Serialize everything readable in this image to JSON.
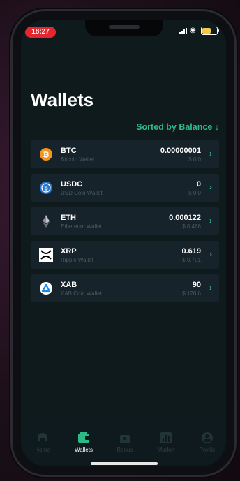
{
  "status": {
    "time": "18:27",
    "battery_charge": 0.6
  },
  "header": {
    "title": "Wallets",
    "sort_label": "Sorted by Balance ↓"
  },
  "wallets": [
    {
      "symbol": "BTC",
      "name": "Bitcoin Wallet",
      "amount": "0.00000001",
      "fiat": "$ 0.0",
      "icon": "bitcoin-icon",
      "color": "#f7931a"
    },
    {
      "symbol": "USDC",
      "name": "USD Coin Wallet",
      "amount": "0",
      "fiat": "$ 0.0",
      "icon": "usdc-icon",
      "color": "#2775ca"
    },
    {
      "symbol": "ETH",
      "name": "Ethereum Wallet",
      "amount": "0.000122",
      "fiat": "$ 0.468",
      "icon": "ethereum-icon",
      "color": "#8c8c9a"
    },
    {
      "symbol": "XRP",
      "name": "Ripple Wallet",
      "amount": "0.619",
      "fiat": "$ 0.701",
      "icon": "ripple-icon",
      "color": "#ffffff"
    },
    {
      "symbol": "XAB",
      "name": "XAB Coin Wallet",
      "amount": "90",
      "fiat": "$ 120.6",
      "icon": "xab-icon",
      "color": "#1e88e5"
    }
  ],
  "tabs": [
    {
      "label": "Home",
      "icon": "home-icon",
      "active": false
    },
    {
      "label": "Wallets",
      "icon": "wallet-icon",
      "active": true
    },
    {
      "label": "Bonus",
      "icon": "bonus-icon",
      "active": false
    },
    {
      "label": "Market",
      "icon": "market-icon",
      "active": false
    },
    {
      "label": "Profile",
      "icon": "profile-icon",
      "active": false
    }
  ],
  "colors": {
    "accent": "#2dba86",
    "tab_active": "#2dba86",
    "tab_inactive": "#233532"
  }
}
